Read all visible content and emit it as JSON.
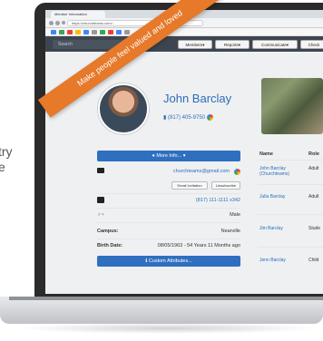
{
  "left_text": {
    "line1": "try",
    "line2": "e"
  },
  "browser": {
    "tab_title": "Member Information",
    "url": "https://churchteams.com/...",
    "search_placeholder": "Search"
  },
  "app_nav": {
    "members_label": "Members",
    "reports_label": "Reports",
    "communicate_label": "Communicate",
    "checkin_label": "Check"
  },
  "banner": {
    "text": "Make people feel valued and loved"
  },
  "profile": {
    "name": "John Barclay",
    "phone_top": "(817) 405-9750",
    "more_info_label": "More Info...",
    "email": "churchteams@gmail.com",
    "email_invitation_label": "Email Invitation",
    "unsubscribe_label": "Unsubscribe",
    "phone": "(817) 111-1111 x342",
    "gender": "Male",
    "campus_label": "Campus:",
    "campus": "Nearville",
    "birth_label": "Birth Date:",
    "birth": "08/05/1963 - 54 Years 11 Months ago",
    "custom_attributes_label": "Custom Attributes..."
  },
  "family": {
    "col_name": "Name",
    "col_role": "Role",
    "members": [
      {
        "name": "John Barclay (Churchteams)",
        "role": "Adult"
      },
      {
        "name": "Julia Barclay",
        "role": "Adult"
      },
      {
        "name": "Jim Barclay",
        "role": "Stude"
      },
      {
        "name": "Jenn Barclay",
        "role": "Child"
      }
    ]
  },
  "colors": {
    "banner": "#e6792a",
    "primary_blue": "#2f6fbf",
    "nav_dark": "#3d4650",
    "link": "#2c6db8"
  }
}
